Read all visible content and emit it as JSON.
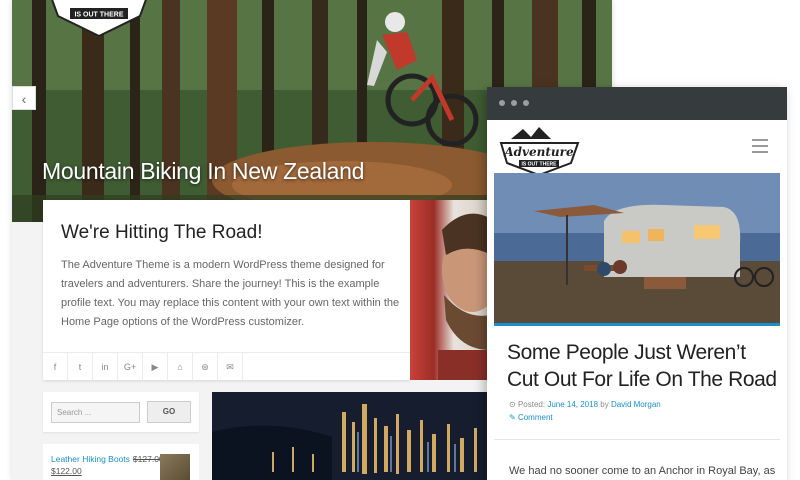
{
  "desktop": {
    "hero": {
      "title": "Mountain Biking In New Zealand",
      "prev_arrow": "‹"
    },
    "logo": {
      "tagline": "IS OUT THERE"
    },
    "intro_card": {
      "heading": "We're Hitting The Road!",
      "body": "The Adventure Theme is a modern WordPress theme designed for travelers and adventurers. Share the journey! This is the example profile text. You may replace this content with your own text within the Home Page options of the WordPress customizer."
    },
    "social_icons": [
      "facebook-icon",
      "twitter-icon",
      "linkedin-icon",
      "google-plus-icon",
      "youtube-icon",
      "github-icon",
      "dribbble-icon",
      "email-icon"
    ],
    "social_glyphs": [
      "f",
      "t",
      "in",
      "G+",
      "▶",
      "⌂",
      "⊛",
      "✉"
    ],
    "search": {
      "placeholder": "Search ...",
      "button_label": "GO"
    },
    "shop": {
      "product_name": "Leather Hiking Boots",
      "old_price": "$127.00",
      "price": "$122.00"
    }
  },
  "mobile": {
    "logo": {
      "wordmark": "Adventure",
      "tagline": "IS OUT THERE"
    },
    "post": {
      "title": "Some People Just Weren’t Cut Out For Life On The Road",
      "posted_label": "Posted:",
      "date": "June 14, 2018",
      "by_label": "by",
      "author": "David Morgan",
      "comment_label": "Comment",
      "excerpt": "We had no sooner come to an Anchor in Royal Bay, as"
    }
  },
  "colors": {
    "accent": "#1a8fc9",
    "mobile_topbar": "#363b3d"
  }
}
